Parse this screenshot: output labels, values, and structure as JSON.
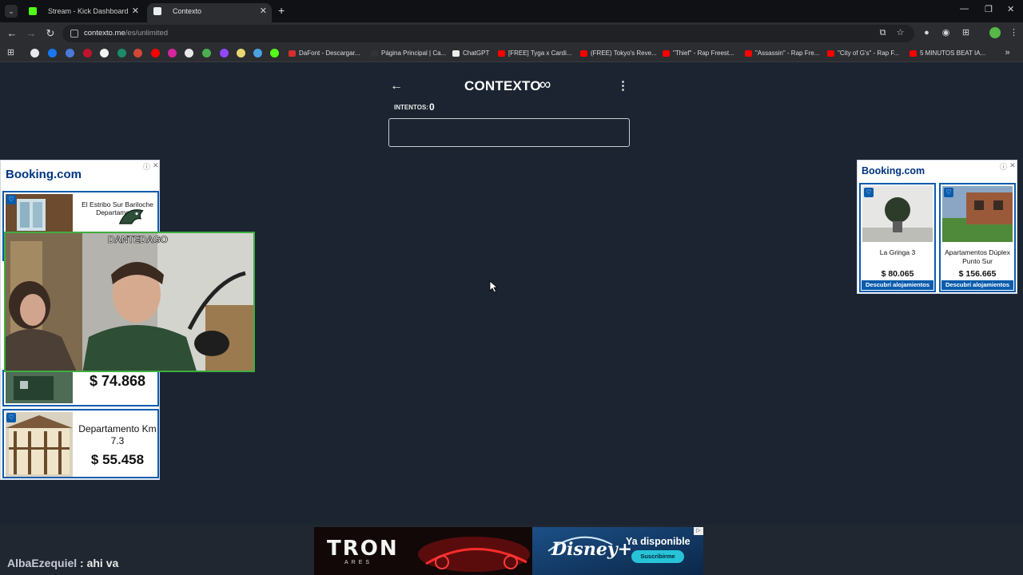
{
  "browser": {
    "tabs": [
      {
        "label": "Stream - Kick Dashboard",
        "active": false,
        "favicon_color": "#53fc18"
      },
      {
        "label": "Contexto",
        "active": true,
        "favicon_color": "#e9edf2"
      }
    ],
    "url_host": "contexto.me",
    "url_path": "/es/unlimited",
    "bookmarks": [
      {
        "label": "DaFont - Descargar...",
        "color": "#d32f2f"
      },
      {
        "label": "Página Principal | Ca...",
        "color": "#222222"
      },
      {
        "label": "ChatGPT",
        "color": "#ececec"
      },
      {
        "label": "[FREE] Tyga x Cardi...",
        "color": "#ff0000"
      },
      {
        "label": "(FREE) Tokyo's Reve...",
        "color": "#ff0000"
      },
      {
        "label": "\"Thief\" - Rap Freest...",
        "color": "#ff0000"
      },
      {
        "label": "\"Assassin\" - Rap Fre...",
        "color": "#ff0000"
      },
      {
        "label": "\"City of G's\" - Rap F...",
        "color": "#ff0000"
      },
      {
        "label": "5 MINUTOS BEAT IA...",
        "color": "#ff0000"
      }
    ]
  },
  "game": {
    "title": "CONTEXTO",
    "mode_symbol": "∞",
    "attempts_label": "INTENTOS:",
    "attempts_value": "0",
    "input_value": "",
    "input_placeholder": ""
  },
  "ad_left": {
    "brand": "Booking.com",
    "cards": [
      {
        "name": "El Estribo Sur Bariloche Departamento",
        "price": ""
      },
      {
        "name": "",
        "price": "$ 74.868"
      },
      {
        "name": "Departamento Km 7.3",
        "price": "$ 55.458"
      }
    ]
  },
  "overlay": {
    "logo_text": "DANTEDAGO"
  },
  "ad_right": {
    "brand": "Booking.com",
    "cards": [
      {
        "name": "La Gringa 3",
        "price": "$ 80.065",
        "cta": "Descubrí alojamientos"
      },
      {
        "name": "Apartamentos Dúplex Punto Sur",
        "price": "$ 156.665",
        "cta": "Descubrí alojamientos"
      }
    ]
  },
  "chat": {
    "user": "AlbaEzequiel",
    "separator": " : ",
    "message": "ahi va"
  },
  "banner": {
    "left_brand": "TRON",
    "left_sub": "ARES",
    "right_brand": "Disney+",
    "right_headline": "Ya disponible",
    "right_cta": "Suscribirme"
  }
}
